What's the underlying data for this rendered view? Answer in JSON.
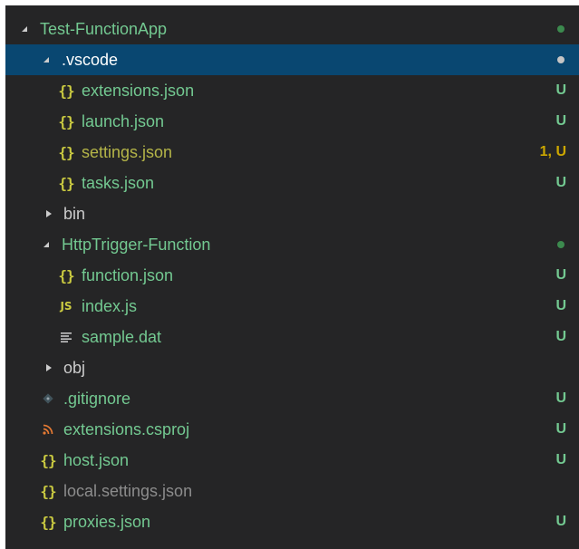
{
  "tree": {
    "root": {
      "label": "Test-FunctionApp",
      "status": "dot",
      "status_color": "#3c8a4e"
    },
    "vscode": {
      "label": ".vscode",
      "status": "dot",
      "status_color": "#c5c5c5"
    },
    "vscode_files": [
      {
        "label": "extensions.json",
        "icon": "json-icon",
        "icon_glyph": "{}",
        "badge": "U",
        "color": "#73c991"
      },
      {
        "label": "launch.json",
        "icon": "json-icon",
        "icon_glyph": "{}",
        "badge": "U",
        "color": "#73c991"
      },
      {
        "label": "settings.json",
        "icon": "json-icon",
        "icon_glyph": "{}",
        "badge": "1, U",
        "color": "#cca700"
      },
      {
        "label": "tasks.json",
        "icon": "json-icon",
        "icon_glyph": "{}",
        "badge": "U",
        "color": "#73c991"
      }
    ],
    "bin": {
      "label": "bin"
    },
    "http_trigger": {
      "label": "HttpTrigger-Function",
      "status": "dot",
      "status_color": "#3c8a4e"
    },
    "http_files": [
      {
        "label": "function.json",
        "icon": "json-icon",
        "icon_glyph": "{}",
        "badge": "U",
        "color": "#73c991"
      },
      {
        "label": "index.js",
        "icon": "js-icon",
        "icon_glyph": "JS",
        "badge": "U",
        "color": "#73c991"
      },
      {
        "label": "sample.dat",
        "icon": "text-file-icon",
        "icon_glyph": "",
        "badge": "U",
        "color": "#73c991"
      }
    ],
    "obj": {
      "label": "obj"
    },
    "root_files": [
      {
        "label": ".gitignore",
        "icon": "git-icon",
        "icon_glyph": "",
        "badge": "U",
        "color": "#73c991"
      },
      {
        "label": "extensions.csproj",
        "icon": "rss-icon",
        "icon_glyph": "",
        "badge": "U",
        "color": "#73c991"
      },
      {
        "label": "host.json",
        "icon": "json-icon",
        "icon_glyph": "{}",
        "badge": "U",
        "color": "#73c991"
      },
      {
        "label": "local.settings.json",
        "icon": "json-icon",
        "icon_glyph": "{}",
        "badge": "",
        "color": "#8c8c8c"
      },
      {
        "label": "proxies.json",
        "icon": "json-icon",
        "icon_glyph": "{}",
        "badge": "U",
        "color": "#73c991"
      }
    ]
  },
  "colors": {
    "background": "#252526",
    "selection": "#094771",
    "untracked": "#73c991",
    "warning": "#cca700",
    "ignored": "#8c8c8c",
    "json_icon": "#cbcb41"
  }
}
